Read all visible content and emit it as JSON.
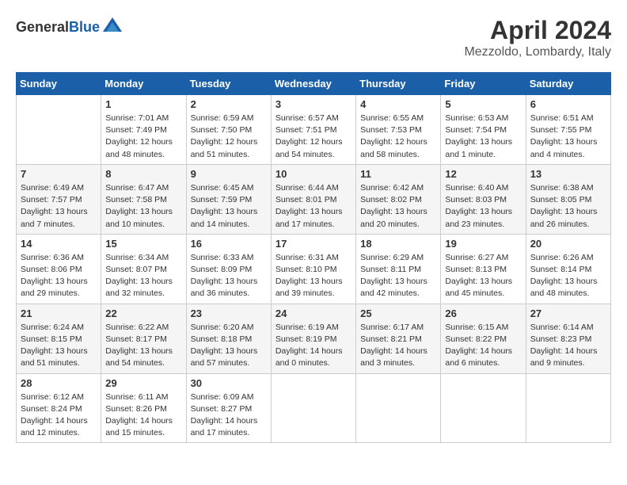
{
  "header": {
    "logo_general": "General",
    "logo_blue": "Blue",
    "title": "April 2024",
    "subtitle": "Mezzoldo, Lombardy, Italy"
  },
  "calendar": {
    "days_of_week": [
      "Sunday",
      "Monday",
      "Tuesday",
      "Wednesday",
      "Thursday",
      "Friday",
      "Saturday"
    ],
    "weeks": [
      [
        {
          "day": "",
          "content": ""
        },
        {
          "day": "1",
          "content": "Sunrise: 7:01 AM\nSunset: 7:49 PM\nDaylight: 12 hours\nand 48 minutes."
        },
        {
          "day": "2",
          "content": "Sunrise: 6:59 AM\nSunset: 7:50 PM\nDaylight: 12 hours\nand 51 minutes."
        },
        {
          "day": "3",
          "content": "Sunrise: 6:57 AM\nSunset: 7:51 PM\nDaylight: 12 hours\nand 54 minutes."
        },
        {
          "day": "4",
          "content": "Sunrise: 6:55 AM\nSunset: 7:53 PM\nDaylight: 12 hours\nand 58 minutes."
        },
        {
          "day": "5",
          "content": "Sunrise: 6:53 AM\nSunset: 7:54 PM\nDaylight: 13 hours\nand 1 minute."
        },
        {
          "day": "6",
          "content": "Sunrise: 6:51 AM\nSunset: 7:55 PM\nDaylight: 13 hours\nand 4 minutes."
        }
      ],
      [
        {
          "day": "7",
          "content": "Sunrise: 6:49 AM\nSunset: 7:57 PM\nDaylight: 13 hours\nand 7 minutes."
        },
        {
          "day": "8",
          "content": "Sunrise: 6:47 AM\nSunset: 7:58 PM\nDaylight: 13 hours\nand 10 minutes."
        },
        {
          "day": "9",
          "content": "Sunrise: 6:45 AM\nSunset: 7:59 PM\nDaylight: 13 hours\nand 14 minutes."
        },
        {
          "day": "10",
          "content": "Sunrise: 6:44 AM\nSunset: 8:01 PM\nDaylight: 13 hours\nand 17 minutes."
        },
        {
          "day": "11",
          "content": "Sunrise: 6:42 AM\nSunset: 8:02 PM\nDaylight: 13 hours\nand 20 minutes."
        },
        {
          "day": "12",
          "content": "Sunrise: 6:40 AM\nSunset: 8:03 PM\nDaylight: 13 hours\nand 23 minutes."
        },
        {
          "day": "13",
          "content": "Sunrise: 6:38 AM\nSunset: 8:05 PM\nDaylight: 13 hours\nand 26 minutes."
        }
      ],
      [
        {
          "day": "14",
          "content": "Sunrise: 6:36 AM\nSunset: 8:06 PM\nDaylight: 13 hours\nand 29 minutes."
        },
        {
          "day": "15",
          "content": "Sunrise: 6:34 AM\nSunset: 8:07 PM\nDaylight: 13 hours\nand 32 minutes."
        },
        {
          "day": "16",
          "content": "Sunrise: 6:33 AM\nSunset: 8:09 PM\nDaylight: 13 hours\nand 36 minutes."
        },
        {
          "day": "17",
          "content": "Sunrise: 6:31 AM\nSunset: 8:10 PM\nDaylight: 13 hours\nand 39 minutes."
        },
        {
          "day": "18",
          "content": "Sunrise: 6:29 AM\nSunset: 8:11 PM\nDaylight: 13 hours\nand 42 minutes."
        },
        {
          "day": "19",
          "content": "Sunrise: 6:27 AM\nSunset: 8:13 PM\nDaylight: 13 hours\nand 45 minutes."
        },
        {
          "day": "20",
          "content": "Sunrise: 6:26 AM\nSunset: 8:14 PM\nDaylight: 13 hours\nand 48 minutes."
        }
      ],
      [
        {
          "day": "21",
          "content": "Sunrise: 6:24 AM\nSunset: 8:15 PM\nDaylight: 13 hours\nand 51 minutes."
        },
        {
          "day": "22",
          "content": "Sunrise: 6:22 AM\nSunset: 8:17 PM\nDaylight: 13 hours\nand 54 minutes."
        },
        {
          "day": "23",
          "content": "Sunrise: 6:20 AM\nSunset: 8:18 PM\nDaylight: 13 hours\nand 57 minutes."
        },
        {
          "day": "24",
          "content": "Sunrise: 6:19 AM\nSunset: 8:19 PM\nDaylight: 14 hours\nand 0 minutes."
        },
        {
          "day": "25",
          "content": "Sunrise: 6:17 AM\nSunset: 8:21 PM\nDaylight: 14 hours\nand 3 minutes."
        },
        {
          "day": "26",
          "content": "Sunrise: 6:15 AM\nSunset: 8:22 PM\nDaylight: 14 hours\nand 6 minutes."
        },
        {
          "day": "27",
          "content": "Sunrise: 6:14 AM\nSunset: 8:23 PM\nDaylight: 14 hours\nand 9 minutes."
        }
      ],
      [
        {
          "day": "28",
          "content": "Sunrise: 6:12 AM\nSunset: 8:24 PM\nDaylight: 14 hours\nand 12 minutes."
        },
        {
          "day": "29",
          "content": "Sunrise: 6:11 AM\nSunset: 8:26 PM\nDaylight: 14 hours\nand 15 minutes."
        },
        {
          "day": "30",
          "content": "Sunrise: 6:09 AM\nSunset: 8:27 PM\nDaylight: 14 hours\nand 17 minutes."
        },
        {
          "day": "",
          "content": ""
        },
        {
          "day": "",
          "content": ""
        },
        {
          "day": "",
          "content": ""
        },
        {
          "day": "",
          "content": ""
        }
      ]
    ]
  }
}
